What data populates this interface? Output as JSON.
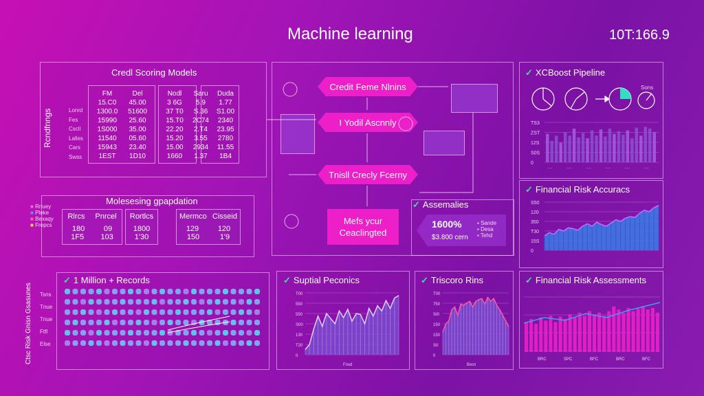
{
  "header": {
    "title": "Machine learning",
    "code": "10T:166.9"
  },
  "credit_scoring": {
    "title": "Credl Scoring Models",
    "side_label": "Rcndfnngs",
    "row_labels": [
      "Lonrd",
      "Fes",
      "Cscll",
      "Lalles",
      "Cars",
      "Swss"
    ],
    "columns": [
      {
        "header": "FM",
        "values": [
          "15.C0",
          "1300.0",
          "15990",
          "1S000",
          "11540",
          "15943",
          "1EST"
        ]
      },
      {
        "header": "Del",
        "values": [
          "45.00",
          "51600",
          "25.60",
          "35.00",
          "05.60",
          "23.40",
          "1D10"
        ]
      },
      {
        "header": "Nodl",
        "values": [
          "3 6G",
          "37 T0",
          "15.T0",
          "22.20",
          "15.20",
          "15.00",
          "1660"
        ]
      },
      {
        "header": "Saru",
        "values": [
          "5.9",
          "S.36",
          "2C74",
          "2.T4",
          "3.55",
          "2934",
          "1.37"
        ]
      },
      {
        "header": "Duda",
        "values": [
          "1.77",
          "S1.00",
          "2340",
          "23.95",
          "2780",
          "11.55",
          "1B4"
        ]
      }
    ]
  },
  "flow": {
    "pills": [
      "Credit Feme Nlnins",
      "I Yodil Ascnnly",
      "Tnisll Crecly Fcerny"
    ],
    "pink_box": [
      "Mefs ycur",
      "Ceaclingted"
    ]
  },
  "processing": {
    "title": "Molesesing gpapdation",
    "legend": [
      "Rnuey",
      "Pleke",
      "Bexaqy",
      "Frepcs"
    ],
    "left_box": {
      "headers": [
        "Rlrcs",
        "Pnrcel"
      ],
      "rows": [
        [
          "180",
          "09"
        ],
        [
          "1F5",
          "103"
        ]
      ]
    },
    "mid_box": {
      "header": "Rortlcs",
      "rows": [
        "1800",
        "1'30"
      ]
    },
    "right_box": {
      "headers": [
        "Mermco",
        "Cisseid"
      ],
      "rows": [
        [
          "129",
          "120"
        ],
        [
          "150",
          "1'9"
        ]
      ]
    }
  },
  "xgboost": {
    "title": "XCBoost Pipeline",
    "pie_label": "Sons",
    "ticks": [
      "TS3",
      "ZST",
      "12S",
      "S0S",
      "0"
    ],
    "bars": [
      32,
      24,
      30,
      22,
      34,
      30,
      38,
      28,
      33,
      27,
      36,
      30,
      37,
      29,
      38,
      32,
      35,
      31,
      36,
      27,
      39,
      30,
      40,
      38,
      34
    ]
  },
  "risk_accuracy": {
    "title": "Financial Risk Accuracs",
    "ticks": [
      "S50",
      "120",
      "350",
      "T30",
      "15S",
      "0"
    ],
    "values": [
      18,
      22,
      20,
      26,
      24,
      28,
      27,
      25,
      30,
      33,
      30,
      35,
      32,
      30,
      34,
      38,
      36,
      40,
      42,
      41,
      46,
      50,
      48,
      53,
      56
    ]
  },
  "assemblies": {
    "title": "Assemalies",
    "big_value": "1600%",
    "sub_value": "$3.800 cern",
    "legend": [
      "Sande",
      "Desa",
      "Tehd"
    ]
  },
  "records": {
    "title": "1 Million + Records",
    "side_label": "Ctsc Risk Gnisn Gsasunes",
    "row_labels": [
      "Tsns",
      "Tnue",
      "Tnue",
      "Ftfl",
      "Else"
    ],
    "dots_per_row": 25
  },
  "suptial": {
    "title": "Suptial Peconics",
    "ticks": [
      "T00",
      "550",
      "550",
      "S00",
      "130",
      "T20",
      "0"
    ],
    "values": [
      10,
      20,
      50,
      75,
      55,
      80,
      70,
      60,
      85,
      72,
      88,
      65,
      80,
      78,
      60,
      90,
      75,
      95,
      85,
      105,
      90,
      110,
      115
    ],
    "axis": "Fnsd"
  },
  "triscoro": {
    "title": "Triscoro Rins",
    "ticks": [
      "T00",
      "750",
      "SI0",
      "150",
      "150",
      "S0",
      "0"
    ],
    "values": [
      40,
      55,
      60,
      80,
      85,
      70,
      90,
      88,
      92,
      95,
      85,
      95,
      98,
      100,
      90,
      102,
      95,
      100,
      88,
      80,
      70,
      60,
      50
    ],
    "axis": "Bxcn"
  },
  "risk_assess": {
    "title": "Financial Risk Assessments",
    "bars": [
      38,
      42,
      36,
      44,
      40,
      46,
      38,
      45,
      42,
      48,
      44,
      50,
      46,
      52,
      48,
      50,
      46,
      52,
      58,
      54,
      50,
      56,
      52,
      55,
      58,
      54,
      56,
      50
    ],
    "labels": [
      "BRC",
      "SPC",
      "BFC",
      "BRC",
      "BFC"
    ]
  },
  "colors": {
    "accent_pink": "#ec1fc8",
    "bar_blue": "#3d7be8",
    "bar_purple": "#8a4fd0",
    "dot_cyan": "#5dd6f0",
    "teal": "#2fe0c0"
  }
}
